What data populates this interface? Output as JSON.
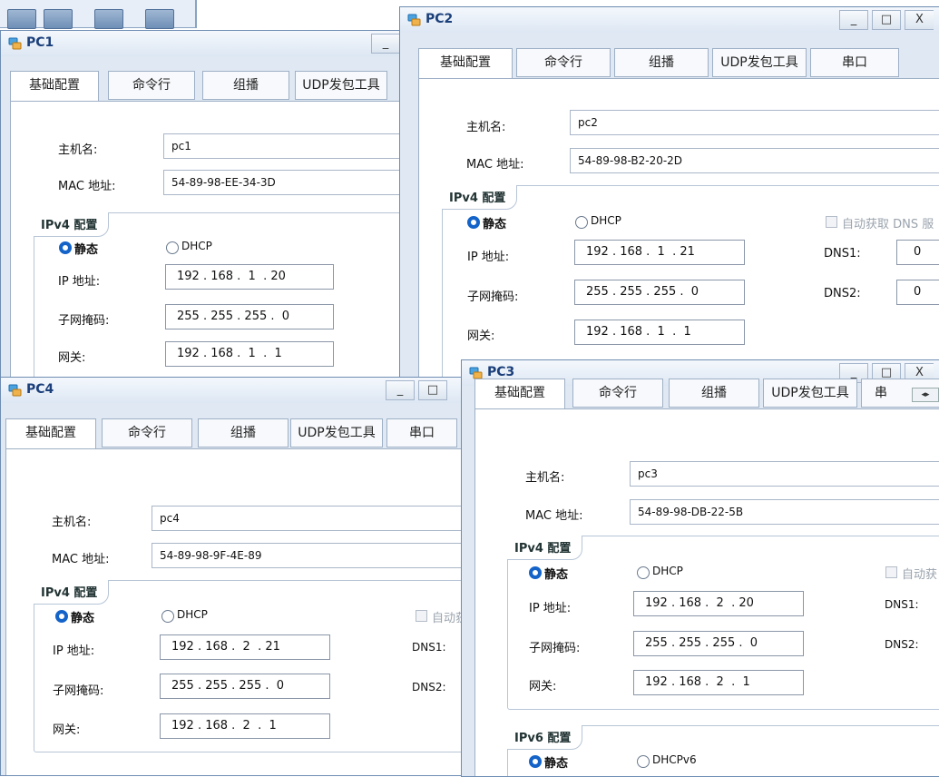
{
  "windows": {
    "pc1": {
      "title": "PC1",
      "tabs": [
        "基础配置",
        "命令行",
        "组播",
        "UDP发包工具"
      ],
      "hostname_label": "主机名:",
      "hostname": "pc1",
      "mac_label": "MAC 地址:",
      "mac": "54-89-98-EE-34-3D",
      "ipv4_group": "IPv4 配置",
      "static_label": "静态",
      "dhcp_label": "DHCP",
      "ip_label": "IP 地址:",
      "ip": "192 . 168 .  1  . 20",
      "mask_label": "子网掩码:",
      "mask": "255 . 255 . 255 .  0",
      "gw_label": "网关:",
      "gw": "192 . 168 .  1  .  1"
    },
    "pc2": {
      "title": "PC2",
      "tabs": [
        "基础配置",
        "命令行",
        "组播",
        "UDP发包工具",
        "串口"
      ],
      "hostname_label": "主机名:",
      "hostname": "pc2",
      "mac_label": "MAC 地址:",
      "mac": "54-89-98-B2-20-2D",
      "ipv4_group": "IPv4 配置",
      "static_label": "静态",
      "dhcp_label": "DHCP",
      "auto_dns_label": "自动获取 DNS 服",
      "ip_label": "IP 地址:",
      "ip": "192 . 168 .  1  . 21",
      "mask_label": "子网掩码:",
      "mask": "255 . 255 . 255 .  0",
      "gw_label": "网关:",
      "gw": "192 . 168 .  1  .  1",
      "dns1_label": "DNS1:",
      "dns1": "0",
      "dns2_label": "DNS2:",
      "dns2": "0"
    },
    "pc3": {
      "title": "PC3",
      "tabs": [
        "基础配置",
        "命令行",
        "组播",
        "UDP发包工具",
        "串"
      ],
      "hostname_label": "主机名:",
      "hostname": "pc3",
      "mac_label": "MAC 地址:",
      "mac": "54-89-98-DB-22-5B",
      "ipv4_group": "IPv4 配置",
      "static_label": "静态",
      "dhcp_label": "DHCP",
      "auto_label": "自动获",
      "ip_label": "IP 地址:",
      "ip": "192 . 168 .  2  . 20",
      "mask_label": "子网掩码:",
      "mask": "255 . 255 . 255 .  0",
      "gw_label": "网关:",
      "gw": "192 . 168 .  2  .  1",
      "dns1_label": "DNS1:",
      "dns2_label": "DNS2:",
      "ipv6_group": "IPv6 配置",
      "static6_label": "静态",
      "dhcpv6_label": "DHCPv6"
    },
    "pc4": {
      "title": "PC4",
      "tabs": [
        "基础配置",
        "命令行",
        "组播",
        "UDP发包工具",
        "串口"
      ],
      "hostname_label": "主机名:",
      "hostname": "pc4",
      "mac_label": "MAC 地址:",
      "mac": "54-89-98-9F-4E-89",
      "ipv4_group": "IPv4 配置",
      "static_label": "静态",
      "dhcp_label": "DHCP",
      "auto_label": "自动获",
      "ip_label": "IP 地址:",
      "ip": "192 . 168 .  2  . 21",
      "mask_label": "子网掩码:",
      "mask": "255 . 255 . 255 .  0",
      "gw_label": "网关:",
      "gw": "192 . 168 .  2  .  1",
      "dns1_label": "DNS1:",
      "dns2_label": "DNS2:"
    }
  },
  "controls": {
    "minimize": "_",
    "maximize": "□",
    "close": "X"
  },
  "colors": {
    "accent": "#1463c9",
    "title": "#1b3f7a",
    "window_bg": "#dfe8f3"
  }
}
